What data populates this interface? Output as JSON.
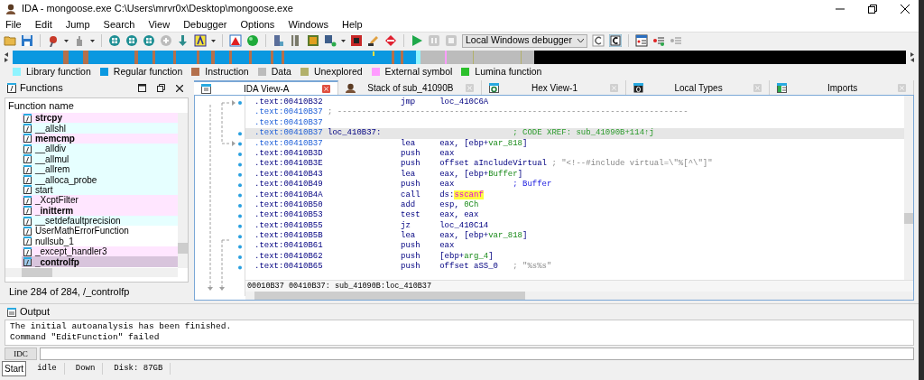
{
  "window": {
    "title": "IDA - mongoose.exe C:\\Users\\mrvr0x\\Desktop\\mongoose.exe"
  },
  "menu": [
    "File",
    "Edit",
    "Jump",
    "Search",
    "View",
    "Debugger",
    "Options",
    "Windows",
    "Help"
  ],
  "toolbar": {
    "debugger": "Local Windows debugger"
  },
  "legend": [
    {
      "label": "Library function",
      "color": "#8ff4ff"
    },
    {
      "label": "Regular function",
      "color": "#0a98e0"
    },
    {
      "label": "Instruction",
      "color": "#b4704c"
    },
    {
      "label": "Data",
      "color": "#bcbcbc"
    },
    {
      "label": "Unexplored",
      "color": "#b2b06a"
    },
    {
      "label": "External symbol",
      "color": "#ff9cff"
    },
    {
      "label": "Lumina function",
      "color": "#2cc02c"
    }
  ],
  "functions": {
    "title": "Functions",
    "column": "Function name",
    "rows": [
      {
        "name": "strcpy",
        "kind": "external",
        "bold": true,
        "selected": false
      },
      {
        "name": "__allshl",
        "kind": "library",
        "bold": false,
        "selected": false
      },
      {
        "name": "memcmp",
        "kind": "external",
        "bold": true,
        "selected": false
      },
      {
        "name": "__alldiv",
        "kind": "library",
        "bold": false,
        "selected": false
      },
      {
        "name": "__allmul",
        "kind": "library",
        "bold": false,
        "selected": false
      },
      {
        "name": "__allrem",
        "kind": "library",
        "bold": false,
        "selected": false
      },
      {
        "name": "__alloca_probe",
        "kind": "library",
        "bold": false,
        "selected": false
      },
      {
        "name": "start",
        "kind": "library",
        "bold": false,
        "selected": false
      },
      {
        "name": "_XcptFilter",
        "kind": "external",
        "bold": false,
        "selected": false
      },
      {
        "name": "_initterm",
        "kind": "external",
        "bold": true,
        "selected": false
      },
      {
        "name": "__setdefaultprecision",
        "kind": "library",
        "bold": false,
        "selected": false
      },
      {
        "name": "UserMathErrorFunction",
        "kind": "regular",
        "bold": false,
        "selected": false
      },
      {
        "name": "nullsub_1",
        "kind": "regular",
        "bold": false,
        "selected": false
      },
      {
        "name": "_except_handler3",
        "kind": "external",
        "bold": false,
        "selected": false
      },
      {
        "name": "_controlfp",
        "kind": "external",
        "bold": true,
        "selected": true
      }
    ],
    "footer": "Line 284 of 284, /_controlfp"
  },
  "tabs": [
    {
      "label": "IDA View-A",
      "kind": "disasm",
      "selected": true
    },
    {
      "label": "Stack of sub_41090B",
      "kind": "stack",
      "selected": false
    },
    {
      "label": "Hex View-1",
      "kind": "hex",
      "selected": false
    },
    {
      "label": "Local Types",
      "kind": "types",
      "selected": false
    },
    {
      "label": "Imports",
      "kind": "imports",
      "selected": false
    }
  ],
  "listing": {
    "lines": [
      {
        "addr": ".text:00410B32",
        "ref": false,
        "selected": false,
        "kind": "code",
        "mnem": "jmp",
        "ops": [
          {
            "text": "loc_410C6A",
            "kind": "plain"
          }
        ]
      },
      {
        "addr": ".text:00410B37",
        "ref": true,
        "selected": false,
        "kind": "separator",
        "comment": {
          "text": "; ------------------------------------------------------------------------",
          "kind": "string"
        }
      },
      {
        "addr": ".text:00410B37",
        "ref": true,
        "selected": false,
        "kind": "blank"
      },
      {
        "addr": ".text:00410B37",
        "ref": true,
        "selected": true,
        "kind": "label",
        "label": "loc_410B37:",
        "comment": {
          "text": "; CODE XREF: sub_41090B+114↑j",
          "kind": "xref"
        }
      },
      {
        "addr": ".text:00410B37",
        "ref": true,
        "selected": false,
        "kind": "code",
        "mnem": "lea",
        "ops": [
          {
            "text": "eax, [ebp+",
            "kind": "plain"
          },
          {
            "text": "var_818",
            "kind": "name"
          },
          {
            "text": "]",
            "kind": "plain"
          }
        ]
      },
      {
        "addr": ".text:00410B3D",
        "ref": false,
        "selected": false,
        "kind": "code",
        "mnem": "push",
        "ops": [
          {
            "text": "eax",
            "kind": "plain"
          }
        ]
      },
      {
        "addr": ".text:00410B3E",
        "ref": false,
        "selected": false,
        "kind": "code",
        "mnem": "push",
        "ops": [
          {
            "text": "offset aIncludeVirtual",
            "kind": "plain"
          }
        ],
        "comment": {
          "text": "; \"<!--#include virtual=\\\"%[^\\\"]\"",
          "kind": "string"
        }
      },
      {
        "addr": ".text:00410B43",
        "ref": false,
        "selected": false,
        "kind": "code",
        "mnem": "lea",
        "ops": [
          {
            "text": "eax, [ebp+",
            "kind": "plain"
          },
          {
            "text": "Buffer",
            "kind": "name"
          },
          {
            "text": "]",
            "kind": "plain"
          }
        ]
      },
      {
        "addr": ".text:00410B49",
        "ref": false,
        "selected": false,
        "kind": "code",
        "mnem": "push",
        "ops": [
          {
            "text": "eax",
            "kind": "plain"
          }
        ],
        "comment": {
          "text": "; Buffer",
          "kind": "regular"
        }
      },
      {
        "addr": ".text:00410B4A",
        "ref": false,
        "selected": false,
        "kind": "code",
        "mnem": "call",
        "ops": [
          {
            "text": "ds:",
            "kind": "plain"
          },
          {
            "text": "sscanf",
            "kind": "highlight"
          }
        ]
      },
      {
        "addr": ".text:00410B50",
        "ref": false,
        "selected": false,
        "kind": "code",
        "mnem": "add",
        "ops": [
          {
            "text": "esp, ",
            "kind": "plain"
          },
          {
            "text": "0Ch",
            "kind": "name"
          }
        ]
      },
      {
        "addr": ".text:00410B53",
        "ref": false,
        "selected": false,
        "kind": "code",
        "mnem": "test",
        "ops": [
          {
            "text": "eax, eax",
            "kind": "plain"
          }
        ]
      },
      {
        "addr": ".text:00410B55",
        "ref": false,
        "selected": false,
        "kind": "code",
        "mnem": "jz",
        "ops": [
          {
            "text": "loc_410C14",
            "kind": "plain"
          }
        ]
      },
      {
        "addr": ".text:00410B5B",
        "ref": false,
        "selected": false,
        "kind": "code",
        "mnem": "lea",
        "ops": [
          {
            "text": "eax, [ebp+",
            "kind": "plain"
          },
          {
            "text": "var_818",
            "kind": "name"
          },
          {
            "text": "]",
            "kind": "plain"
          }
        ]
      },
      {
        "addr": ".text:00410B61",
        "ref": false,
        "selected": false,
        "kind": "code",
        "mnem": "push",
        "ops": [
          {
            "text": "eax",
            "kind": "plain"
          }
        ]
      },
      {
        "addr": ".text:00410B62",
        "ref": false,
        "selected": false,
        "kind": "code",
        "mnem": "push",
        "ops": [
          {
            "text": "[ebp+",
            "kind": "plain"
          },
          {
            "text": "arg_4",
            "kind": "name"
          },
          {
            "text": "]",
            "kind": "plain"
          }
        ]
      },
      {
        "addr": ".text:00410B65",
        "ref": false,
        "selected": false,
        "kind": "code",
        "mnem": "push",
        "ops": [
          {
            "text": "offset aSS_0",
            "kind": "plain"
          }
        ],
        "comment": {
          "text": "; \"%s%s\"",
          "kind": "string"
        }
      }
    ],
    "location": "00010B37 00410B37: sub_41090B:loc_410B37"
  },
  "output": {
    "title": "Output",
    "lines": [
      "The initial autoanalysis has been finished.",
      "Command \"EditFunction\" failed"
    ],
    "button": "IDC"
  },
  "status_bar": {
    "tooltip": "Start",
    "items": [
      "idle",
      "Down",
      "Disk: 87GB"
    ]
  }
}
